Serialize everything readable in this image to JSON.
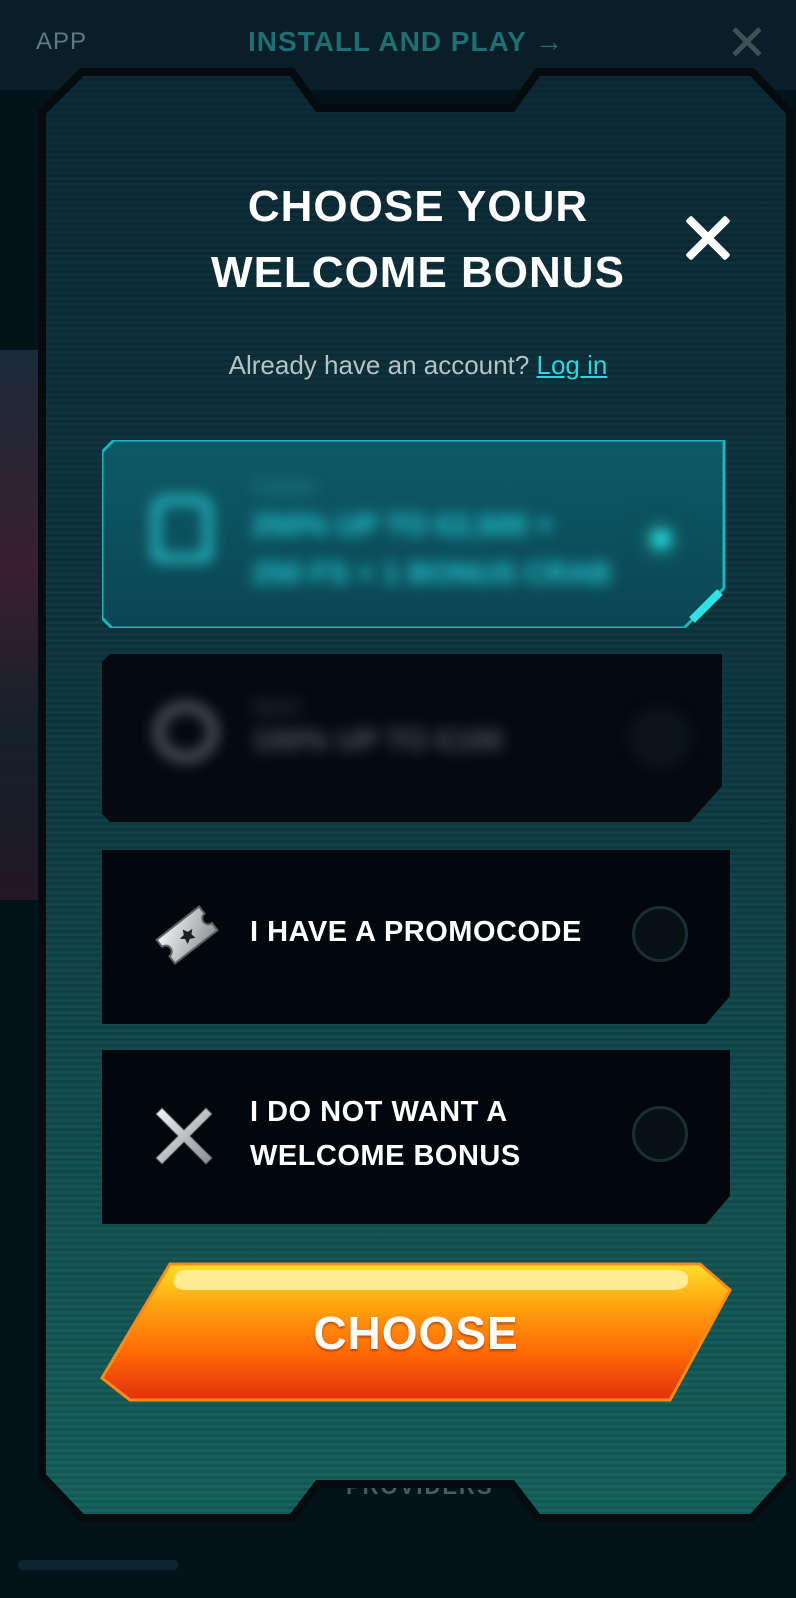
{
  "background": {
    "app_label": "APP",
    "install_label": "INSTALL AND PLAY →",
    "close_glyph": "✕",
    "providers_label": "PROVIDERS"
  },
  "modal": {
    "title_line1": "CHOOSE YOUR",
    "title_line2": "WELCOME BONUS",
    "account_prompt": "Already have an account?",
    "login_label": "Log in"
  },
  "options": {
    "casino": {
      "category": "Casino",
      "offer_line1": "250% UP TO €2,500 +",
      "offer_line2": "250 FS + 1 BONUS CRAB",
      "icon": "slot-machine-icon",
      "selected": true
    },
    "sport": {
      "category": "Sport",
      "offer": "100% UP TO €100",
      "icon": "sports-ball-icon",
      "selected": false
    },
    "promocode": {
      "label": "I HAVE A PROMOCODE",
      "icon": "ticket-icon",
      "selected": false
    },
    "no_bonus": {
      "label_line1": "I DO NOT WANT A",
      "label_line2": "WELCOME BONUS",
      "icon": "cross-icon",
      "selected": false
    }
  },
  "choose_button": {
    "label": "CHOOSE"
  },
  "colors": {
    "accent_cyan": "#2ee3e8",
    "link": "#30d4e0",
    "button_top": "#ffd21f",
    "button_bottom": "#e8330a"
  }
}
